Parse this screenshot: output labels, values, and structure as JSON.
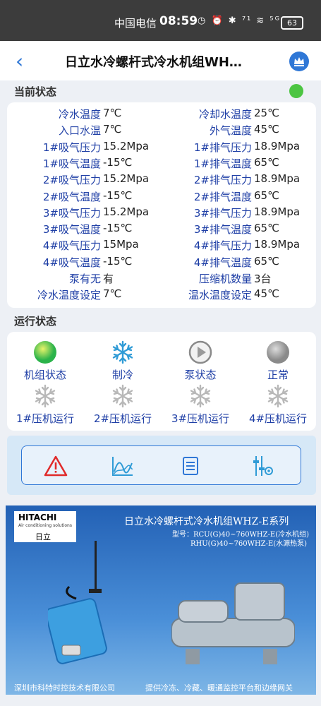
{
  "status_bar": {
    "carrier": "中国电信",
    "time": "08:59",
    "icons": "◷ ⏰ ✱ ⁷¹ ≋ ⁵ᴳ",
    "battery": "63"
  },
  "app_bar": {
    "title": "日立水冷螺杆式冷水机组WH…"
  },
  "current_status": {
    "title": "当前状态",
    "rows": [
      {
        "l1": "冷水温度",
        "v1": "7℃",
        "l2": "冷却水温度",
        "v2": "25℃"
      },
      {
        "l1": "入口水温",
        "v1": "7℃",
        "l2": "外气温度",
        "v2": "45℃"
      },
      {
        "l1": "1#吸气压力",
        "v1": "15.2Mpa",
        "l2": "1#排气压力",
        "v2": "18.9Mpa"
      },
      {
        "l1": "1#吸气温度",
        "v1": "-15℃",
        "l2": "1#排气温度",
        "v2": "65℃"
      },
      {
        "l1": "2#吸气压力",
        "v1": "15.2Mpa",
        "l2": "2#排气压力",
        "v2": "18.9Mpa"
      },
      {
        "l1": "2#吸气温度",
        "v1": "-15℃",
        "l2": "2#排气温度",
        "v2": "65℃"
      },
      {
        "l1": "3#吸气压力",
        "v1": "15.2Mpa",
        "l2": "3#排气压力",
        "v2": "18.9Mpa"
      },
      {
        "l1": "3#吸气温度",
        "v1": "-15℃",
        "l2": "3#排气温度",
        "v2": "65℃"
      },
      {
        "l1": "4#吸气压力",
        "v1": "15Mpa",
        "l2": "4#排气压力",
        "v2": "18.9Mpa"
      },
      {
        "l1": "4#吸气温度",
        "v1": "-15℃",
        "l2": "4#排气温度",
        "v2": "65℃"
      },
      {
        "l1": "泵有无",
        "v1": "有",
        "l2": "压缩机数量",
        "v2": "3台"
      },
      {
        "l1": "冷水温度设定",
        "v1": "7℃",
        "l2": "温水温度设定",
        "v2": "45℃"
      }
    ]
  },
  "run_status": {
    "title": "运行状态",
    "items": [
      {
        "label": "机组状态",
        "icon": "green-ball-icon"
      },
      {
        "label": "制冷",
        "icon": "snowflake-icon"
      },
      {
        "label": "泵状态",
        "icon": "play-icon"
      },
      {
        "label": "正常",
        "icon": "gray-ball-icon"
      },
      {
        "label": "1#压机运行",
        "icon": "snowflake-gray-icon"
      },
      {
        "label": "2#压机运行",
        "icon": "snowflake-gray-icon"
      },
      {
        "label": "3#压机运行",
        "icon": "snowflake-gray-icon"
      },
      {
        "label": "4#压机运行",
        "icon": "snowflake-gray-icon"
      }
    ]
  },
  "toolbar": {
    "icons": [
      "alarm-icon",
      "chart-icon",
      "list-icon",
      "settings-icon"
    ]
  },
  "banner": {
    "brand": "HITACHI",
    "brand_sub": "Air conditioning solutions",
    "brand_cn": "日立",
    "title": "日立水冷螺杆式冷水机组WHZ-E系列",
    "model1": "型号：RCU(G)40~760WHZ-E(冷水机组)",
    "model2": "RHU(G)40~760WHZ-E(水源热泵)",
    "footer_left": "深圳市科特时控技术有限公司",
    "footer_right": "提供冷冻、冷藏、暖通监控平台和边缘网关"
  },
  "colors": {
    "accent": "#2f77d6",
    "label_blue": "#1f3fa6",
    "status_green": "#4cc542"
  }
}
